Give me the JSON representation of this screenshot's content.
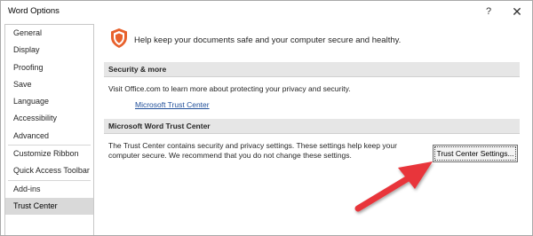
{
  "window": {
    "title": "Word Options",
    "help_glyph": "?",
    "close_glyph": "✕"
  },
  "sidebar": {
    "items": [
      {
        "label": "General"
      },
      {
        "label": "Display"
      },
      {
        "label": "Proofing"
      },
      {
        "label": "Save"
      },
      {
        "label": "Language"
      },
      {
        "label": "Accessibility"
      },
      {
        "label": "Advanced"
      },
      {
        "label": "Customize Ribbon"
      },
      {
        "label": "Quick Access Toolbar"
      },
      {
        "label": "Add-ins"
      },
      {
        "label": "Trust Center",
        "selected": true
      }
    ]
  },
  "main": {
    "intro": "Help keep your documents safe and your computer secure and healthy.",
    "security_section": {
      "header": "Security & more",
      "text": "Visit Office.com to learn more about protecting your privacy and security.",
      "link": "Microsoft Trust Center"
    },
    "trust_section": {
      "header": "Microsoft Word Trust Center",
      "text_line1": "The Trust Center contains security and privacy settings. These settings help keep your",
      "text_line2": "computer secure. We recommend that you do not change these settings.",
      "button_label": "Trust Center Settings..."
    }
  },
  "icons": {
    "shield": "shield-icon",
    "arrow": "red-arrow-annotation"
  },
  "colors": {
    "shield": "#e8612c",
    "arrow": "#e8343a",
    "link": "#1f4e99",
    "selected": "#d9d9d9"
  }
}
